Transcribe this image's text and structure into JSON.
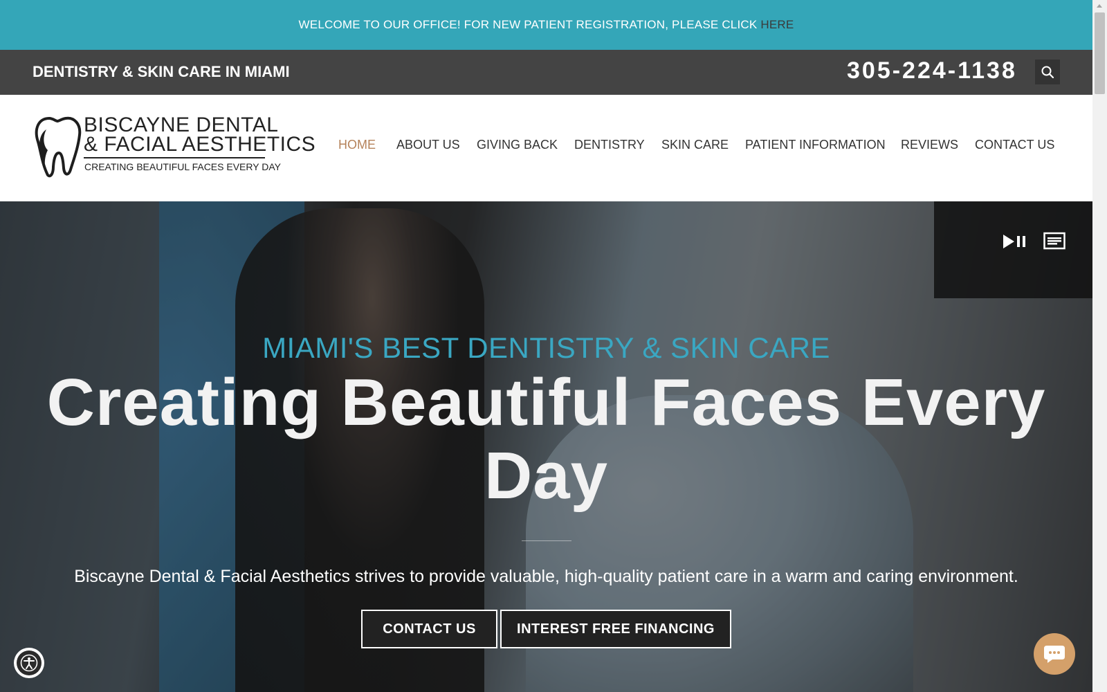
{
  "announcement": {
    "text": "WELCOME TO OUR OFFICE! FOR NEW PATIENT REGISTRATION, PLEASE CLICK",
    "link": "HERE"
  },
  "topbar": {
    "tagline": "DENTISTRY & SKIN CARE IN MIAMI",
    "phone": "305-224-1138",
    "search_icon": "search-icon"
  },
  "logo": {
    "line1": "BISCAYNE DENTAL",
    "line2": "& FACIAL AESTHETICS",
    "line3": "CREATING BEAUTIFUL FACES EVERY DAY"
  },
  "nav": {
    "items": [
      {
        "label": "HOME",
        "active": true
      },
      {
        "label": "ABOUT US",
        "active": false
      },
      {
        "label": "GIVING BACK",
        "active": false
      },
      {
        "label": "DENTISTRY",
        "active": false
      },
      {
        "label": "SKIN CARE",
        "active": false
      },
      {
        "label": "PATIENT INFORMATION",
        "active": false
      },
      {
        "label": "REVIEWS",
        "active": false
      },
      {
        "label": "CONTACT US",
        "active": false
      }
    ]
  },
  "hero": {
    "kicker": "MIAMI'S BEST DENTISTRY & SKIN CARE",
    "headline": "Creating Beautiful Faces Every Day",
    "subtext": "Biscayne Dental & Facial Aesthetics strives to provide valuable, high-quality patient care in a warm and caring environment.",
    "buttons": {
      "contact": "CONTACT US",
      "financing": "INTEREST FREE FINANCING"
    },
    "video_controls": [
      "play-pause-icon",
      "captions-icon"
    ]
  },
  "widgets": {
    "accessibility": "accessibility-icon",
    "chat": "chat-icon"
  },
  "colors": {
    "announce_bg": "#34a6b8",
    "topbar_bg": "#444444",
    "nav_active": "#b5825a",
    "kicker": "#3aa7c2",
    "chat_bg": "#d4a06a"
  }
}
